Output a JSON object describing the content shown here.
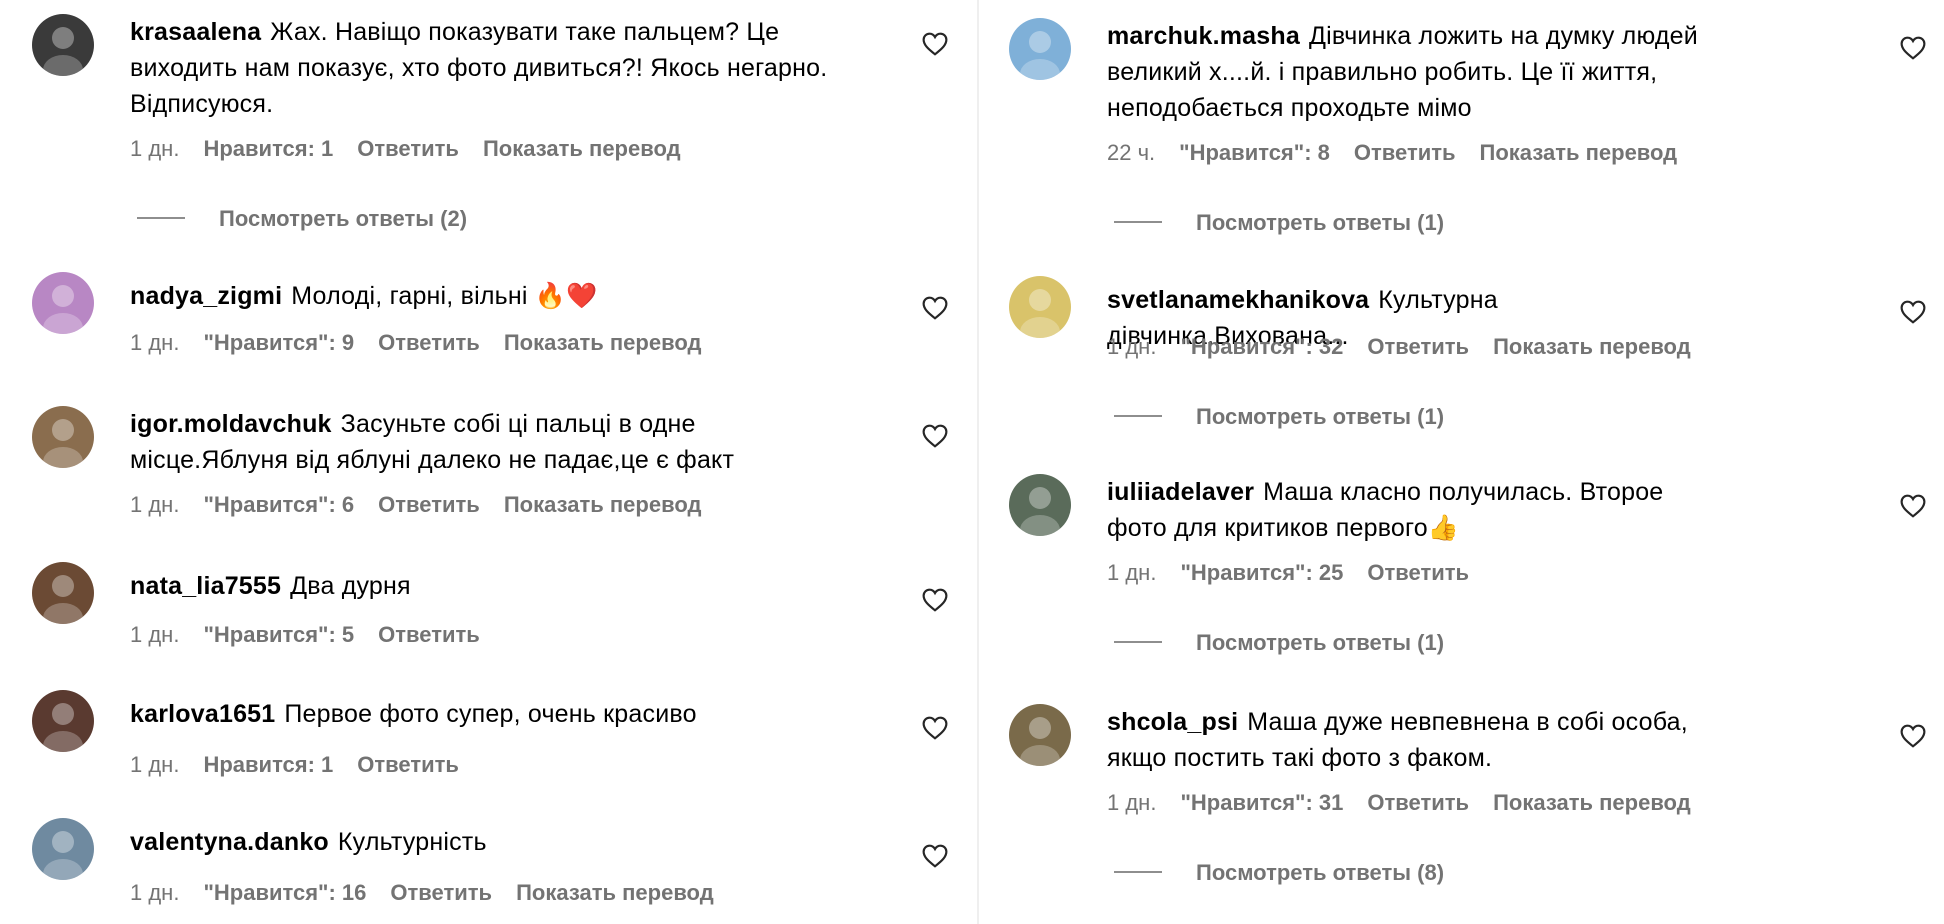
{
  "left": [
    {
      "user": "krasaalena",
      "text": "Жах. Навіщо показувати таке пальцем? Це виходить нам показує, хто фото дивиться?! Якось негарно. Відписуюся.",
      "time": "1 дн.",
      "likes": "Нравится: 1",
      "reply": "Ответить",
      "translate": "Показать перевод",
      "replies": "Посмотреть ответы (2)",
      "avatar_color": "#3a3a3a"
    },
    {
      "user": "nadya_zigmi",
      "text": "Молоді, гарні, вільні 🔥❤️",
      "time": "1 дн.",
      "likes": "\"Нравится\": 9",
      "reply": "Ответить",
      "translate": "Показать перевод",
      "avatar_color": "#b887c4"
    },
    {
      "user": "igor.moldavchuk",
      "text": "Засуньте собі ці пальці в одне місце.Яблуня від яблуні далеко не падає,це є факт",
      "time": "1 дн.",
      "likes": "\"Нравится\": 6",
      "reply": "Ответить",
      "translate": "Показать перевод",
      "avatar_color": "#8a6d4e"
    },
    {
      "user": "nata_lia7555",
      "text": "Два дурня",
      "time": "1 дн.",
      "likes": "\"Нравится\": 5",
      "reply": "Ответить",
      "avatar_color": "#6b4a34"
    },
    {
      "user": "karlova1651",
      "text": "Первое фото супер, очень красиво",
      "time": "1 дн.",
      "likes": "Нравится: 1",
      "reply": "Ответить",
      "avatar_color": "#5a3a30"
    },
    {
      "user": "valentyna.danko",
      "text": "Культурність",
      "time": "1 дн.",
      "likes": "\"Нравится\": 16",
      "reply": "Ответить",
      "translate": "Показать перевод",
      "avatar_color": "#6f8aa0"
    }
  ],
  "right": [
    {
      "user": "marchuk.masha",
      "text": "Дівчинка ложить на думку людей великий х....й. і правильно робить. Це її життя, неподобається проходьте мімо",
      "time": "22 ч.",
      "likes": "\"Нравится\": 8",
      "reply": "Ответить",
      "translate": "Показать перевод",
      "replies": "Посмотреть ответы (1)",
      "avatar_color": "#7fb0d8"
    },
    {
      "user": "svetlanamekhanikova",
      "text": "Культурна дівчинка.Вихована...",
      "time": "1 дн.",
      "likes": "\"Нравится\": 32",
      "reply": "Ответить",
      "translate": "Показать перевод",
      "replies": "Посмотреть ответы (1)",
      "avatar_color": "#d9c36a"
    },
    {
      "user": "iuliiadelaver",
      "text": "Маша класно получилась. Второе фото для критиков первого👍",
      "time": "1 дн.",
      "likes": "\"Нравится\": 25",
      "reply": "Ответить",
      "replies": "Посмотреть ответы (1)",
      "avatar_color": "#5a6b5a"
    },
    {
      "user": "shcola_psi",
      "text": "Маша дуже невпевнена в собі особа, якщо постить такі фото з факом.",
      "time": "1 дн.",
      "likes": "\"Нравится\": 31",
      "reply": "Ответить",
      "translate": "Показать перевод",
      "replies": "Посмотреть ответы (8)",
      "avatar_color": "#7a6a4a"
    }
  ],
  "icons": {
    "like": "heart-icon",
    "reply_line": "reply-line"
  }
}
